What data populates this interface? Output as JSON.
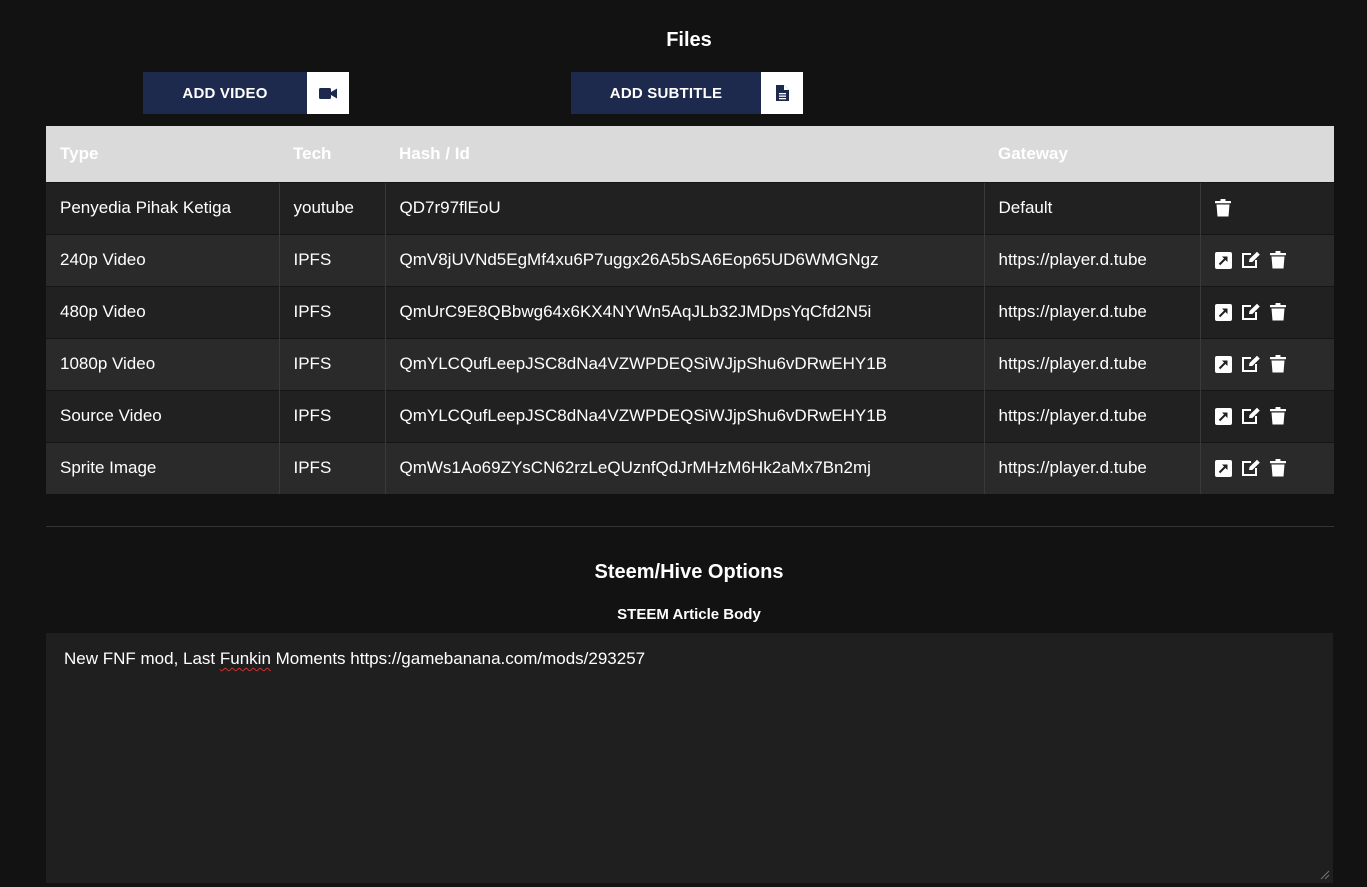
{
  "files": {
    "title": "Files",
    "add_video_label": "ADD VIDEO",
    "add_subtitle_label": "ADD SUBTITLE",
    "add_video_icon": "video-camera-icon",
    "add_subtitle_icon": "document-icon",
    "table": {
      "headers": [
        "Type",
        "Tech",
        "Hash / Id",
        "Gateway",
        ""
      ],
      "rows": [
        {
          "type": "Penyedia Pihak Ketiga",
          "tech": "youtube",
          "hash": "QD7r97flEoU",
          "gateway": "Default",
          "actions": [
            "delete"
          ]
        },
        {
          "type": "240p Video",
          "tech": "IPFS",
          "hash": "QmV8jUVNd5EgMf4xu6P7uggx26A5bSA6Eop65UD6WMGNgz",
          "gateway": "https://player.d.tube",
          "actions": [
            "open",
            "edit",
            "delete"
          ]
        },
        {
          "type": "480p Video",
          "tech": "IPFS",
          "hash": "QmUrC9E8QBbwg64x6KX4NYWn5AqJLb32JMDpsYqCfd2N5i",
          "gateway": "https://player.d.tube",
          "actions": [
            "open",
            "edit",
            "delete"
          ]
        },
        {
          "type": "1080p Video",
          "tech": "IPFS",
          "hash": "QmYLCQufLeepJSC8dNa4VZWPDEQSiWJjpShu6vDRwEHY1B",
          "gateway": "https://player.d.tube",
          "actions": [
            "open",
            "edit",
            "delete"
          ]
        },
        {
          "type": "Source Video",
          "tech": "IPFS",
          "hash": "QmYLCQufLeepJSC8dNa4VZWPDEQSiWJjpShu6vDRwEHY1B",
          "gateway": "https://player.d.tube",
          "actions": [
            "open",
            "edit",
            "delete"
          ]
        },
        {
          "type": "Sprite Image",
          "tech": "IPFS",
          "hash": "QmWs1Ao69ZYsCN62rzLeQUznfQdJrMHzM6Hk2aMx7Bn2mj",
          "gateway": "https://player.d.tube",
          "actions": [
            "open",
            "edit",
            "delete"
          ]
        }
      ]
    }
  },
  "steem": {
    "title": "Steem/Hive Options",
    "body_label": "STEEM Article Body",
    "body_prefix": "New FNF mod, Last ",
    "body_misspelled": "Funkin",
    "body_suffix": " Moments https://gamebanana.com/mods/293257"
  },
  "colors": {
    "background": "#121212",
    "button": "#1e2a4d",
    "header": "#dadada",
    "row_odd": "#212121",
    "row_even": "#2a2a2a"
  }
}
